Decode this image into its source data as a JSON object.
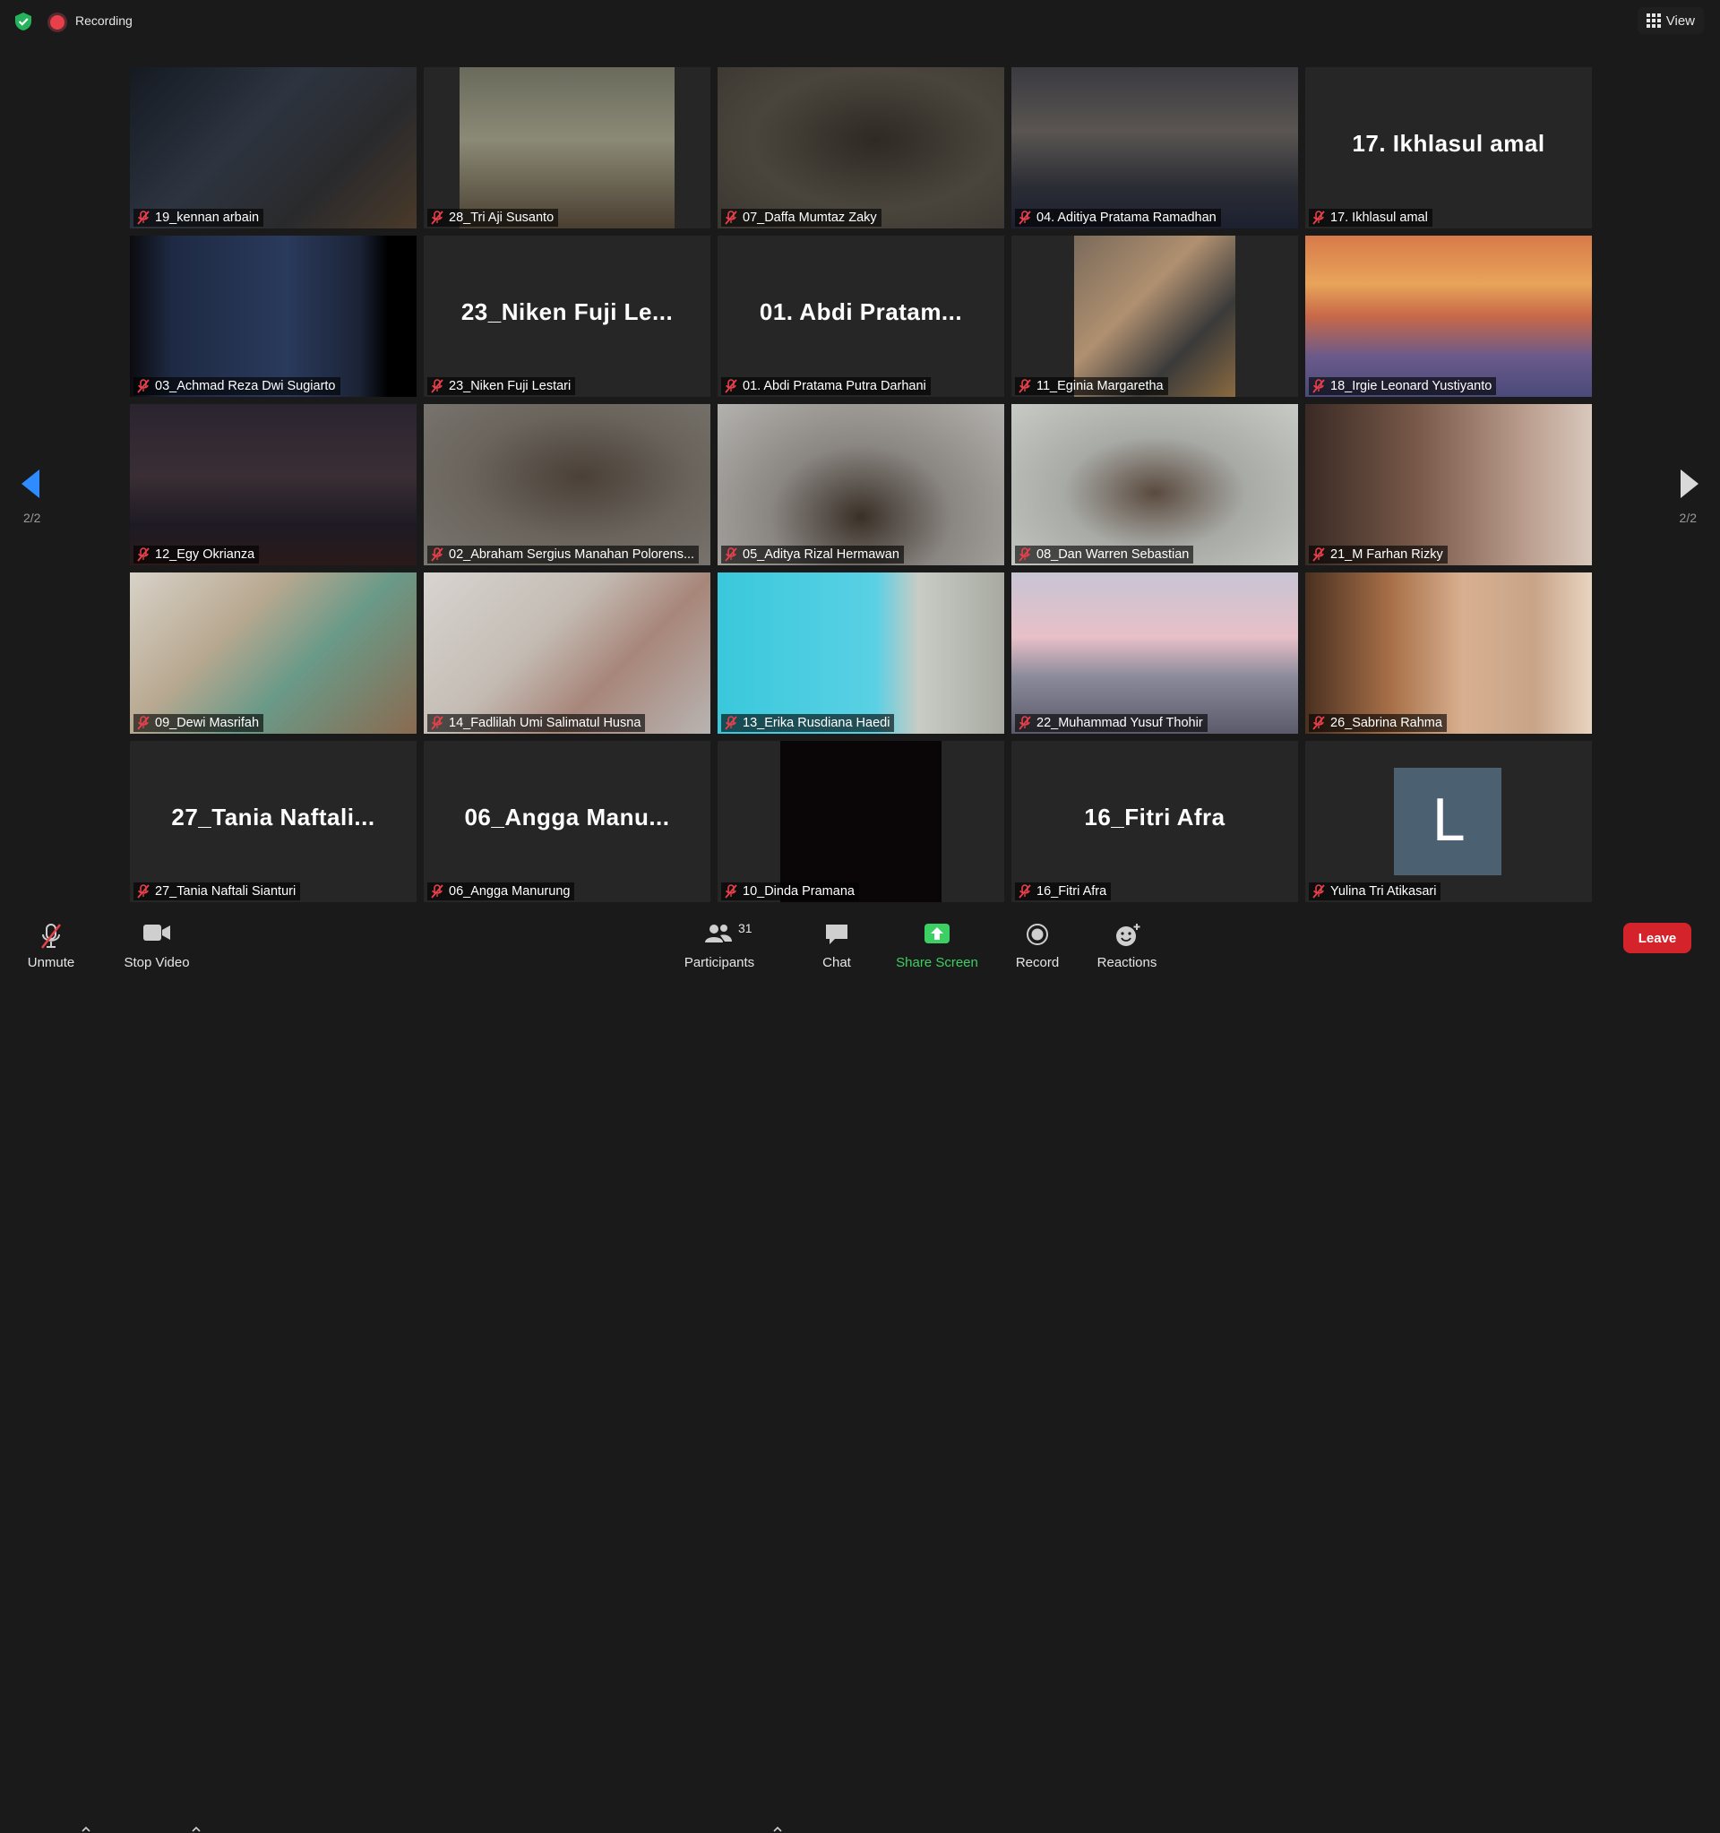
{
  "top_bar": {
    "recording_label": "Recording",
    "view_label": "View"
  },
  "pagination": {
    "left_page": "2/2",
    "right_page": "2/2"
  },
  "participants": [
    {
      "name": "19_kennan arbain",
      "muted": true,
      "video": true
    },
    {
      "name": "28_Tri Aji Susanto",
      "muted": true,
      "video": true
    },
    {
      "name": "07_Daffa Mumtaz Zaky",
      "muted": true,
      "video": true
    },
    {
      "name": "04. Aditiya Pratama Ramadhan",
      "muted": true,
      "video": true
    },
    {
      "name": "17. Ikhlasul amal",
      "display": "17. Ikhlasul amal",
      "muted": true,
      "video": false
    },
    {
      "name": "03_Achmad Reza Dwi Sugiarto",
      "muted": true,
      "video": true
    },
    {
      "name": "23_Niken Fuji Lestari",
      "display": "23_Niken Fuji Le...",
      "muted": true,
      "video": false
    },
    {
      "name": "01. Abdi Pratama Putra Darhani",
      "display": "01. Abdi Pratam...",
      "muted": true,
      "video": false
    },
    {
      "name": "11_Eginia Margaretha",
      "muted": true,
      "video": true
    },
    {
      "name": "18_Irgie Leonard Yustiyanto",
      "muted": true,
      "video": true
    },
    {
      "name": "12_Egy Okrianza",
      "muted": true,
      "video": true
    },
    {
      "name": "02_Abraham Sergius Manahan Polorens...",
      "muted": true,
      "video": true
    },
    {
      "name": "05_Aditya Rizal Hermawan",
      "muted": true,
      "video": true
    },
    {
      "name": "08_Dan Warren Sebastian",
      "muted": true,
      "video": true
    },
    {
      "name": "21_M Farhan Rizky",
      "muted": true,
      "video": true
    },
    {
      "name": "09_Dewi Masrifah",
      "muted": true,
      "video": true
    },
    {
      "name": "14_Fadlilah Umi Salimatul Husna",
      "muted": true,
      "video": true
    },
    {
      "name": "13_Erika Rusdiana Haedi",
      "muted": true,
      "video": true
    },
    {
      "name": "22_Muhammad Yusuf Thohir",
      "muted": true,
      "video": true
    },
    {
      "name": "26_Sabrina Rahma",
      "muted": true,
      "video": true
    },
    {
      "name": "27_Tania Naftali Sianturi",
      "display": "27_Tania Naftali...",
      "muted": true,
      "video": false
    },
    {
      "name": "06_Angga Manurung",
      "display": "06_Angga Manu...",
      "muted": true,
      "video": false
    },
    {
      "name": "10_Dinda Pramana",
      "muted": true,
      "video": true
    },
    {
      "name": "16_Fitri Afra",
      "display": "16_Fitri Afra",
      "muted": true,
      "video": false
    },
    {
      "name": "Yulina Tri Atikasari",
      "avatar_letter": "L",
      "muted": true,
      "video": false
    }
  ],
  "toolbar": {
    "unmute_label": "Unmute",
    "stop_video_label": "Stop Video",
    "participants_label": "Participants",
    "participants_count": "31",
    "chat_label": "Chat",
    "share_screen_label": "Share Screen",
    "record_label": "Record",
    "reactions_label": "Reactions",
    "leave_label": "Leave"
  },
  "colors": {
    "background": "#1a1a1a",
    "tile": "#262626",
    "share_green": "#3ccf63",
    "leave_red": "#d4232a",
    "muted_red": "#e8404a",
    "arrow_blue": "#2d8cff"
  }
}
